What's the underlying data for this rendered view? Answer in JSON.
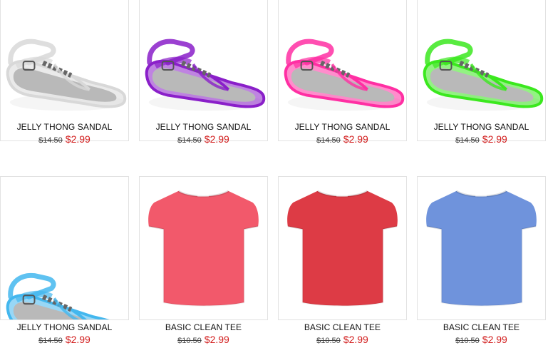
{
  "products": [
    {
      "name": "JELLY THONG SANDAL",
      "old_price": "$14.50",
      "price": "$2.99",
      "kind": "sandal",
      "color": "#d8d8d8",
      "icon": "clear-jelly-sandal-image"
    },
    {
      "name": "JELLY THONG SANDAL",
      "old_price": "$14.50",
      "price": "$2.99",
      "kind": "sandal",
      "color": "#8a1fc9",
      "icon": "purple-jelly-sandal-image"
    },
    {
      "name": "JELLY THONG SANDAL",
      "old_price": "$14.50",
      "price": "$2.99",
      "kind": "sandal",
      "color": "#ff2fa3",
      "icon": "pink-jelly-sandal-image"
    },
    {
      "name": "JELLY THONG SANDAL",
      "old_price": "$14.50",
      "price": "$2.99",
      "kind": "sandal",
      "color": "#3be81e",
      "icon": "green-jelly-sandal-image"
    },
    {
      "name": "JELLY THONG SANDAL",
      "old_price": "$14.50",
      "price": "$2.99",
      "kind": "sandal",
      "color": "#43b7ee",
      "icon": "blue-jelly-sandal-image"
    },
    {
      "name": "BASIC CLEAN TEE",
      "old_price": "$10.50",
      "price": "$2.99",
      "kind": "tee",
      "color": "#f2596b",
      "icon": "coral-tee-image"
    },
    {
      "name": "BASIC CLEAN TEE",
      "old_price": "$10.50",
      "price": "$2.99",
      "kind": "tee",
      "color": "#dd3b45",
      "icon": "red-tee-image"
    },
    {
      "name": "BASIC CLEAN TEE",
      "old_price": "$10.50",
      "price": "$2.99",
      "kind": "tee",
      "color": "#6f93dc",
      "icon": "blue-tee-image"
    }
  ]
}
